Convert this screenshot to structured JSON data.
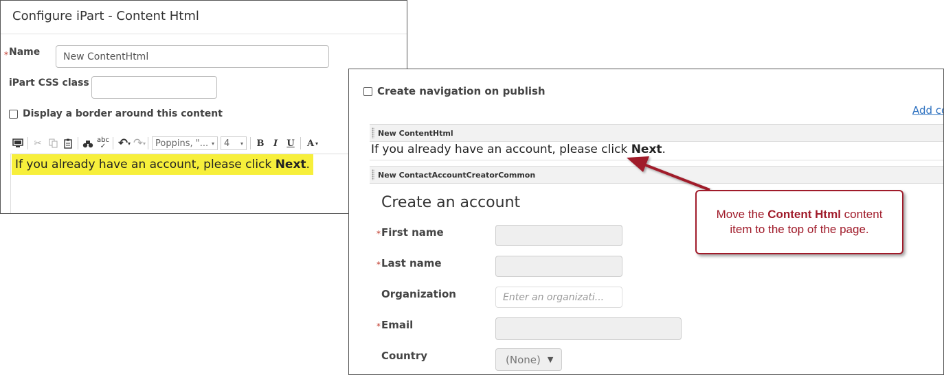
{
  "left_panel": {
    "title": "Configure iPart - Content Html",
    "name_label": "Name",
    "name_value": "New ContentHtml",
    "css_label": "iPart CSS class",
    "css_value": "",
    "border_label": "Display a border around this content",
    "toolbar": {
      "font_family": "Poppins, \"...",
      "font_size": "4",
      "bold": "B",
      "italic": "I",
      "underline": "U",
      "font_color": "A"
    },
    "editor_text": "If you already have an account, please click ",
    "editor_bold": "Next",
    "editor_end": "."
  },
  "right_panel": {
    "nav_label": "Create navigation on publish",
    "add_link": "Add co",
    "content_item_1": {
      "header": "New ContentHtml",
      "text": "If you already have an account, please click ",
      "bold": "Next",
      "end": "."
    },
    "content_item_2": {
      "header": "New ContactAccountCreatorCommon",
      "heading": "Create an account",
      "fields": {
        "first_name": "First name",
        "last_name": "Last name",
        "organization": "Organization",
        "organization_placeholder": "Enter an organizati...",
        "email": "Email",
        "country": "Country",
        "country_value": "(None)"
      }
    }
  },
  "callout": {
    "line1_pre": "Move the ",
    "line1_bold": "Content Html",
    "line1_post": " content",
    "line2": "item to the top of the page.",
    "color": "#a01b2a"
  }
}
